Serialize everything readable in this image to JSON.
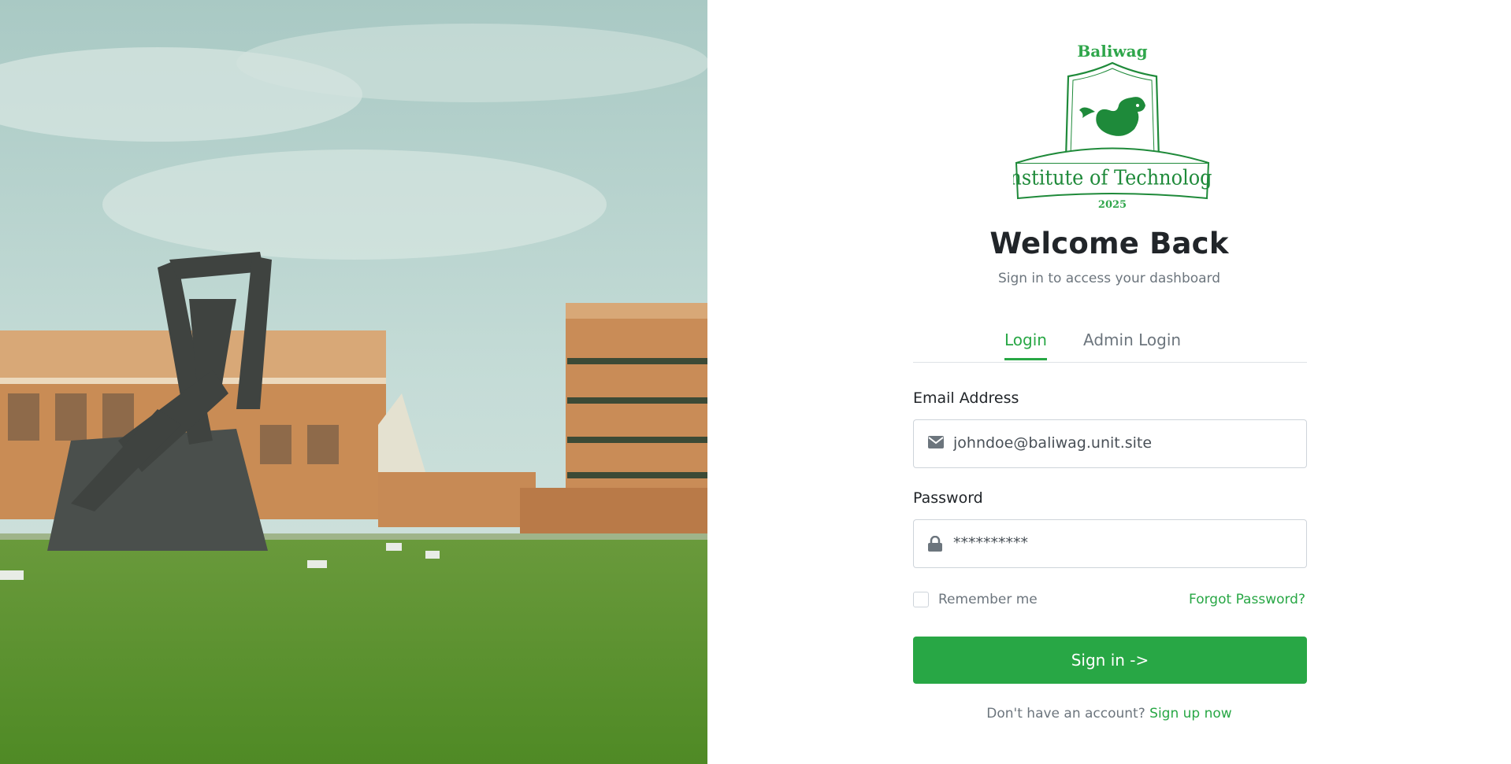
{
  "hero": {
    "image_alt": "Campus photo with statue and buildings"
  },
  "logo": {
    "top_text": "Baliwag",
    "banner_text": "Institute of Technology",
    "year": "2025"
  },
  "header": {
    "title": "Welcome Back",
    "subtitle": "Sign in to access your dashboard"
  },
  "tabs": [
    {
      "label": "Login",
      "active": true
    },
    {
      "label": "Admin Login",
      "active": false
    }
  ],
  "form": {
    "email_label": "Email Address",
    "email_value": "johndoe@baliwag.unit.site",
    "password_label": "Password",
    "password_value": "**********",
    "remember_label": "Remember me",
    "remember_checked": false,
    "forgot_label": "Forgot Password?",
    "submit_label": "Sign in ->"
  },
  "footer": {
    "prompt": "Don't have an account?",
    "signup_label": "Sign up now"
  },
  "colors": {
    "accent": "#28a745",
    "muted": "#6c757d",
    "border": "#ced4da"
  },
  "icons": {
    "email": "envelope-icon",
    "password": "lock-icon"
  }
}
